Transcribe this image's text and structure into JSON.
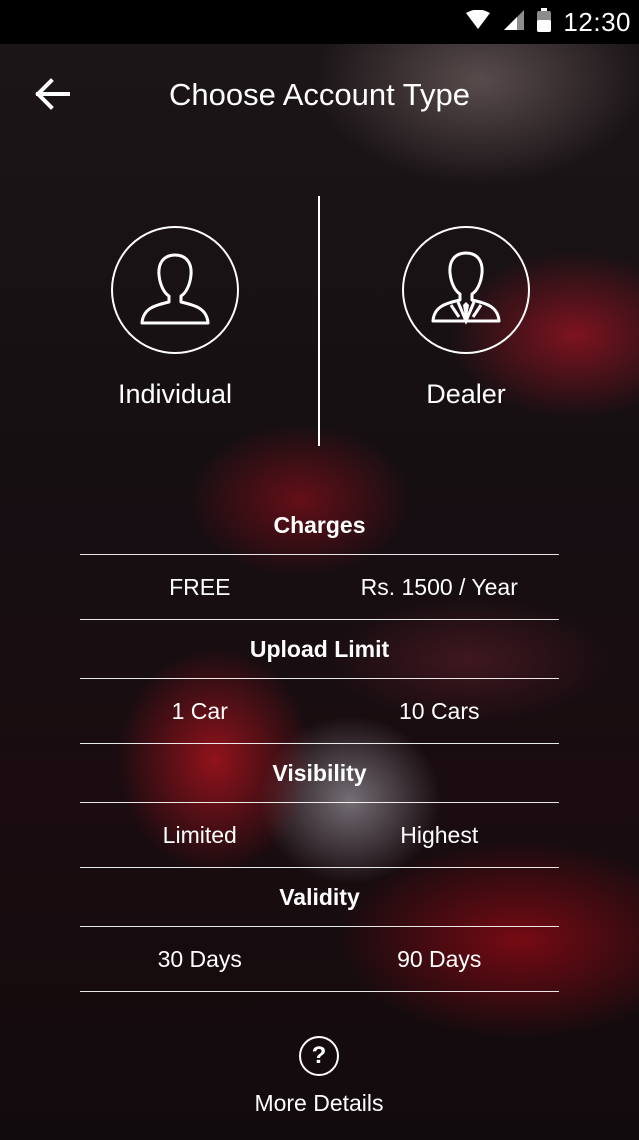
{
  "status_bar": {
    "time": "12:30",
    "icons": [
      "wifi-icon",
      "cell-signal-icon",
      "battery-icon"
    ]
  },
  "header": {
    "title": "Choose Account Type",
    "back_icon": "arrow-left-icon"
  },
  "account_types": [
    {
      "label": "Individual",
      "icon": "person-icon"
    },
    {
      "label": "Dealer",
      "icon": "businessman-icon"
    }
  ],
  "comparison": [
    {
      "heading": "Charges",
      "individual": "FREE",
      "dealer": "Rs. 1500 / Year"
    },
    {
      "heading": "Upload Limit",
      "individual": "1 Car",
      "dealer": "10 Cars"
    },
    {
      "heading": "Visibility",
      "individual": "Limited",
      "dealer": "Highest"
    },
    {
      "heading": "Validity",
      "individual": "30 Days",
      "dealer": "90 Days"
    }
  ],
  "more_details": {
    "label": "More Details",
    "icon_glyph": "?"
  },
  "colors": {
    "text": "#ffffff",
    "status_bar": "#000000",
    "accent_red": "#a0141e"
  }
}
